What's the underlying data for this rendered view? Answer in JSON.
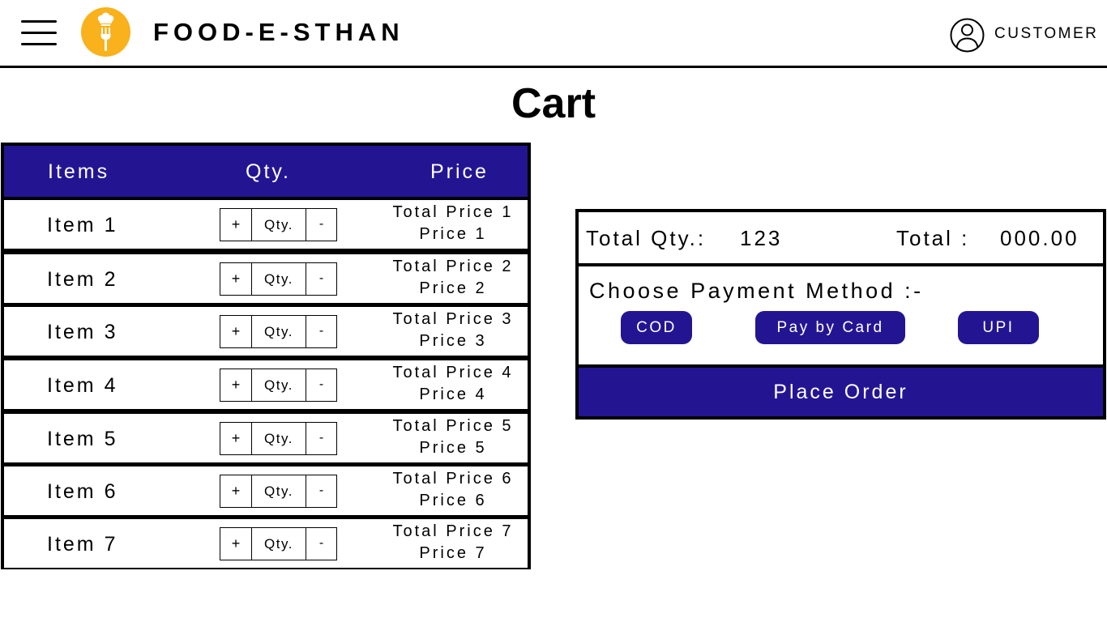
{
  "header": {
    "brand": "FOOD-E-STHAN",
    "user_label": "CUSTOMER",
    "menu_icon": "hamburger-menu-icon",
    "logo_icon": "chef-fork-logo",
    "user_icon": "user-profile-icon",
    "accent_color": "#F9B11C"
  },
  "page": {
    "title": "Cart"
  },
  "cart": {
    "headers": {
      "items": "Items",
      "qty": "Qty.",
      "price": "Price"
    },
    "rows": [
      {
        "item": "Item 1",
        "plus": "+",
        "qty": "Qty.",
        "minus": "-",
        "total_price": "Total Price 1",
        "price": "Price 1"
      },
      {
        "item": "Item 2",
        "plus": "+",
        "qty": "Qty.",
        "minus": "-",
        "total_price": "Total Price 2",
        "price": "Price 2"
      },
      {
        "item": "Item 3",
        "plus": "+",
        "qty": "Qty.",
        "minus": "-",
        "total_price": "Total Price 3",
        "price": "Price 3"
      },
      {
        "item": "Item 4",
        "plus": "+",
        "qty": "Qty.",
        "minus": "-",
        "total_price": "Total Price 4",
        "price": "Price 4"
      },
      {
        "item": "Item 5",
        "plus": "+",
        "qty": "Qty.",
        "minus": "-",
        "total_price": "Total Price 5",
        "price": "Price 5"
      },
      {
        "item": "Item 6",
        "plus": "+",
        "qty": "Qty.",
        "minus": "-",
        "total_price": "Total Price 6",
        "price": "Price 6"
      },
      {
        "item": "Item 7",
        "plus": "+",
        "qty": "Qty.",
        "minus": "-",
        "total_price": "Total Price 7",
        "price": "Price 7"
      }
    ]
  },
  "summary": {
    "total_qty_label": "Total Qty.:",
    "total_qty_value": "123",
    "total_label": "Total :",
    "total_value": "000.00",
    "payment_title": "Choose Payment Method :-",
    "payment_methods": [
      "COD",
      "Pay by Card",
      "UPI"
    ],
    "place_order": "Place Order"
  },
  "colors": {
    "primary": "#231592",
    "border": "#000000",
    "background": "#FFFFFF",
    "text_on_primary": "#FFFFFF"
  }
}
